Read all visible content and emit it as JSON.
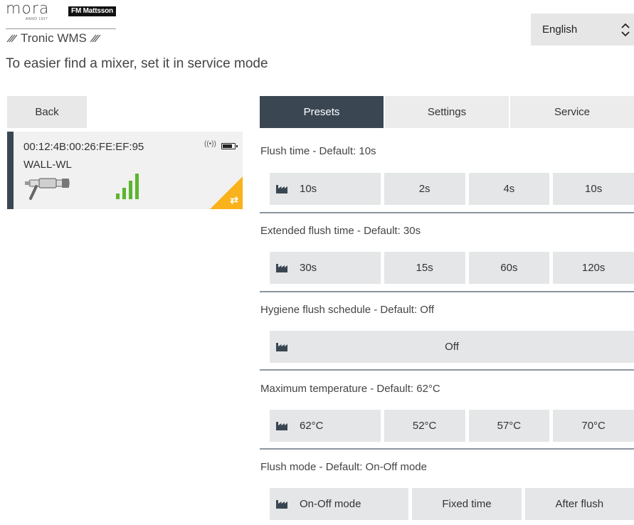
{
  "header": {
    "brand_mora": "mora",
    "brand_anno": "ANNO 1927",
    "brand_fm": "FM Mattsson",
    "brand_tronic": "Tronic WMS",
    "subtitle": "To easier find a mixer, set it in service mode"
  },
  "language": {
    "selected": "English"
  },
  "left": {
    "back_label": "Back",
    "device": {
      "mac": "00:12:4B:00:26:FE:EF:95",
      "type": "WALL-WL",
      "signal_bars": 4
    }
  },
  "tabs": [
    {
      "label": "Presets",
      "active": true
    },
    {
      "label": "Settings",
      "active": false
    },
    {
      "label": "Service",
      "active": false
    }
  ],
  "sections": [
    {
      "title": "Flush time - Default: 10s",
      "options": [
        "10s",
        "2s",
        "4s",
        "10s"
      ]
    },
    {
      "title": "Extended flush time - Default: 30s",
      "options": [
        "30s",
        "15s",
        "60s",
        "120s"
      ]
    },
    {
      "title": "Hygiene flush schedule - Default: Off",
      "options": [
        "Off"
      ]
    },
    {
      "title": "Maximum temperature - Default: 62°C",
      "options": [
        "62°C",
        "52°C",
        "57°C",
        "70°C"
      ]
    },
    {
      "title": "Flush mode - Default: On-Off mode",
      "options": [
        "On-Off mode",
        "Fixed time",
        "After flush"
      ]
    }
  ],
  "colors": {
    "accent_dark": "#3a4752",
    "signal_green": "#5cb52e",
    "service_yellow": "#f9b21b"
  },
  "icons": {
    "default_marker": "factory-icon",
    "corner": "swap-arrows-icon",
    "antenna": "antenna-icon",
    "battery": "battery-icon"
  }
}
